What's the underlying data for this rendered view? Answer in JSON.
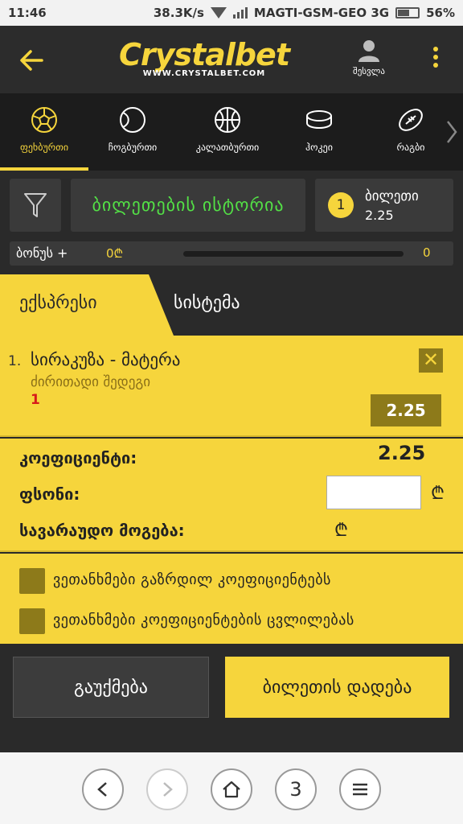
{
  "status_bar": {
    "time": "11:46",
    "speed": "38.3K/s",
    "carrier": "MAGTI-GSM-GEO 3G",
    "battery": "56%"
  },
  "header": {
    "logo_text": "Crystalbet",
    "logo_url": "WWW.CRYSTALBET.COM",
    "user_label": "შესვლა",
    "accent_color": "#f6d53c"
  },
  "sports": [
    {
      "label": "ფეხბურთი",
      "icon": "soccer-ball-icon",
      "active": true
    },
    {
      "label": "ჩოგბურთი",
      "icon": "tennis-ball-icon",
      "active": false
    },
    {
      "label": "კალათბურთი",
      "icon": "basketball-icon",
      "active": false
    },
    {
      "label": "ჰოკეი",
      "icon": "hockey-puck-icon",
      "active": false
    },
    {
      "label": "რაგბი",
      "icon": "rugby-ball-icon",
      "active": false
    }
  ],
  "toolbar": {
    "history_label": "ბილეთების ისტორია",
    "ticket_count": "1",
    "ticket_label": "ბილეთი",
    "ticket_odds": "2.25",
    "bonus_label": "ბონუს +",
    "bonus_amount": "0₾",
    "bonus_count": "0"
  },
  "tabs": {
    "express": "ექსპრესი",
    "system": "სისტემა"
  },
  "bet": {
    "number": "1.",
    "match": "სირაკუზა - მატერა",
    "market": "ძირითადი შედეგი",
    "pick": "1",
    "odds": "2.25",
    "close": "✕"
  },
  "summary": {
    "coef_label": "კოეფიციენტი:",
    "coef_value": "2.25",
    "stake_label": "ფსონი:",
    "stake_value": "",
    "win_label": "სავარაუდო მოგება:",
    "currency": "₾"
  },
  "options": [
    "ვეთანხმები გაზრდილ კოეფიციენტებს",
    "ვეთანხმები კოეფიციენტების ცვლილებას"
  ],
  "actions": {
    "clear": "გაუქმება",
    "place": "ბილეთის დადება"
  },
  "browser": {
    "tabs_count": "3"
  }
}
